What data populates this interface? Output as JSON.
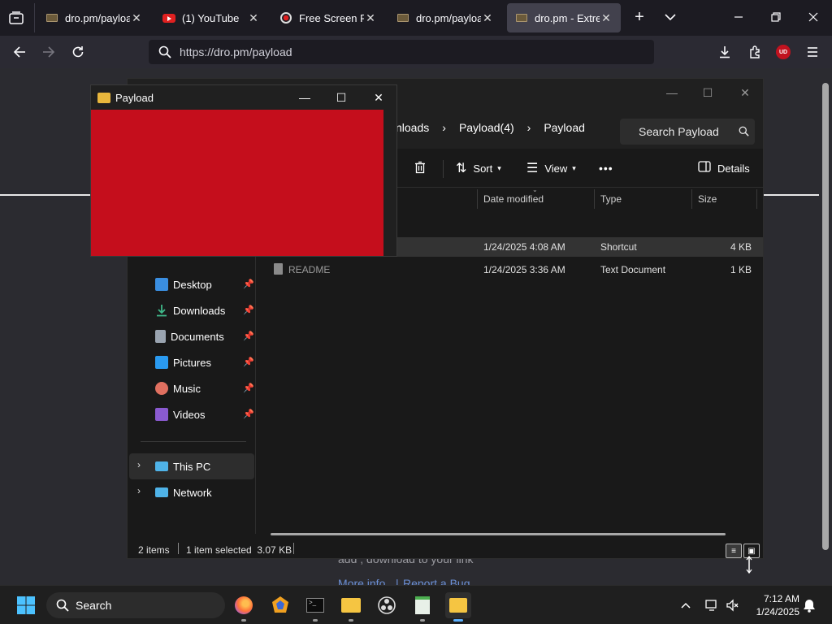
{
  "browser": {
    "tabs": [
      {
        "title": "dro.pm/payload",
        "icon": "film-favicon",
        "active": false
      },
      {
        "title": "(1) YouTube",
        "icon": "youtube-favicon",
        "active": false
      },
      {
        "title": "Free Screen Reco",
        "icon": "record-favicon",
        "active": false
      },
      {
        "title": "dro.pm/payload",
        "icon": "film-favicon",
        "active": false
      },
      {
        "title": "dro.pm - Extrem",
        "icon": "film-favicon",
        "active": true
      }
    ],
    "url": "https://dro.pm/payload",
    "extension_badge": "UD"
  },
  "page": {
    "partial_text_1": "add , download to your link",
    "link_more_info": "More info",
    "link_sep": "|",
    "link_report": "Report a Bug"
  },
  "explorer": {
    "breadcrumbs": [
      "nloads",
      "Payload(4)",
      "Payload"
    ],
    "search_placeholder": "Search Payload",
    "toolbar": {
      "sort": "Sort",
      "view": "View",
      "more": "•••",
      "details": "Details"
    },
    "columns": [
      "Date modified",
      "Type",
      "Size"
    ],
    "files": [
      {
        "name": "",
        "date": "1/24/2025 4:08 AM",
        "type": "Shortcut",
        "size": "4 KB",
        "selected": true
      },
      {
        "name": "README",
        "date": "1/24/2025 3:36 AM",
        "type": "Text Document",
        "size": "1 KB",
        "selected": false
      }
    ],
    "quick_access": [
      {
        "label": "Desktop",
        "icon": "desktop-icon",
        "color": "#3a8ee0"
      },
      {
        "label": "Downloads",
        "icon": "downloads-icon",
        "color": "#3fb98a"
      },
      {
        "label": "Documents",
        "icon": "documents-icon",
        "color": "#9aa4b0"
      },
      {
        "label": "Pictures",
        "icon": "pictures-icon",
        "color": "#2a9af0"
      },
      {
        "label": "Music",
        "icon": "music-icon",
        "color": "#e07060"
      },
      {
        "label": "Videos",
        "icon": "videos-icon",
        "color": "#8a5ad0"
      }
    ],
    "this_pc": "This PC",
    "network": "Network",
    "status": {
      "items": "2 items",
      "selected": "1 item selected  3.07 KB"
    }
  },
  "payload_window": {
    "title": "Payload",
    "fill_color": "#c50e1c"
  },
  "taskbar": {
    "search": "Search",
    "time": "7:12 AM",
    "date": "1/24/2025"
  }
}
